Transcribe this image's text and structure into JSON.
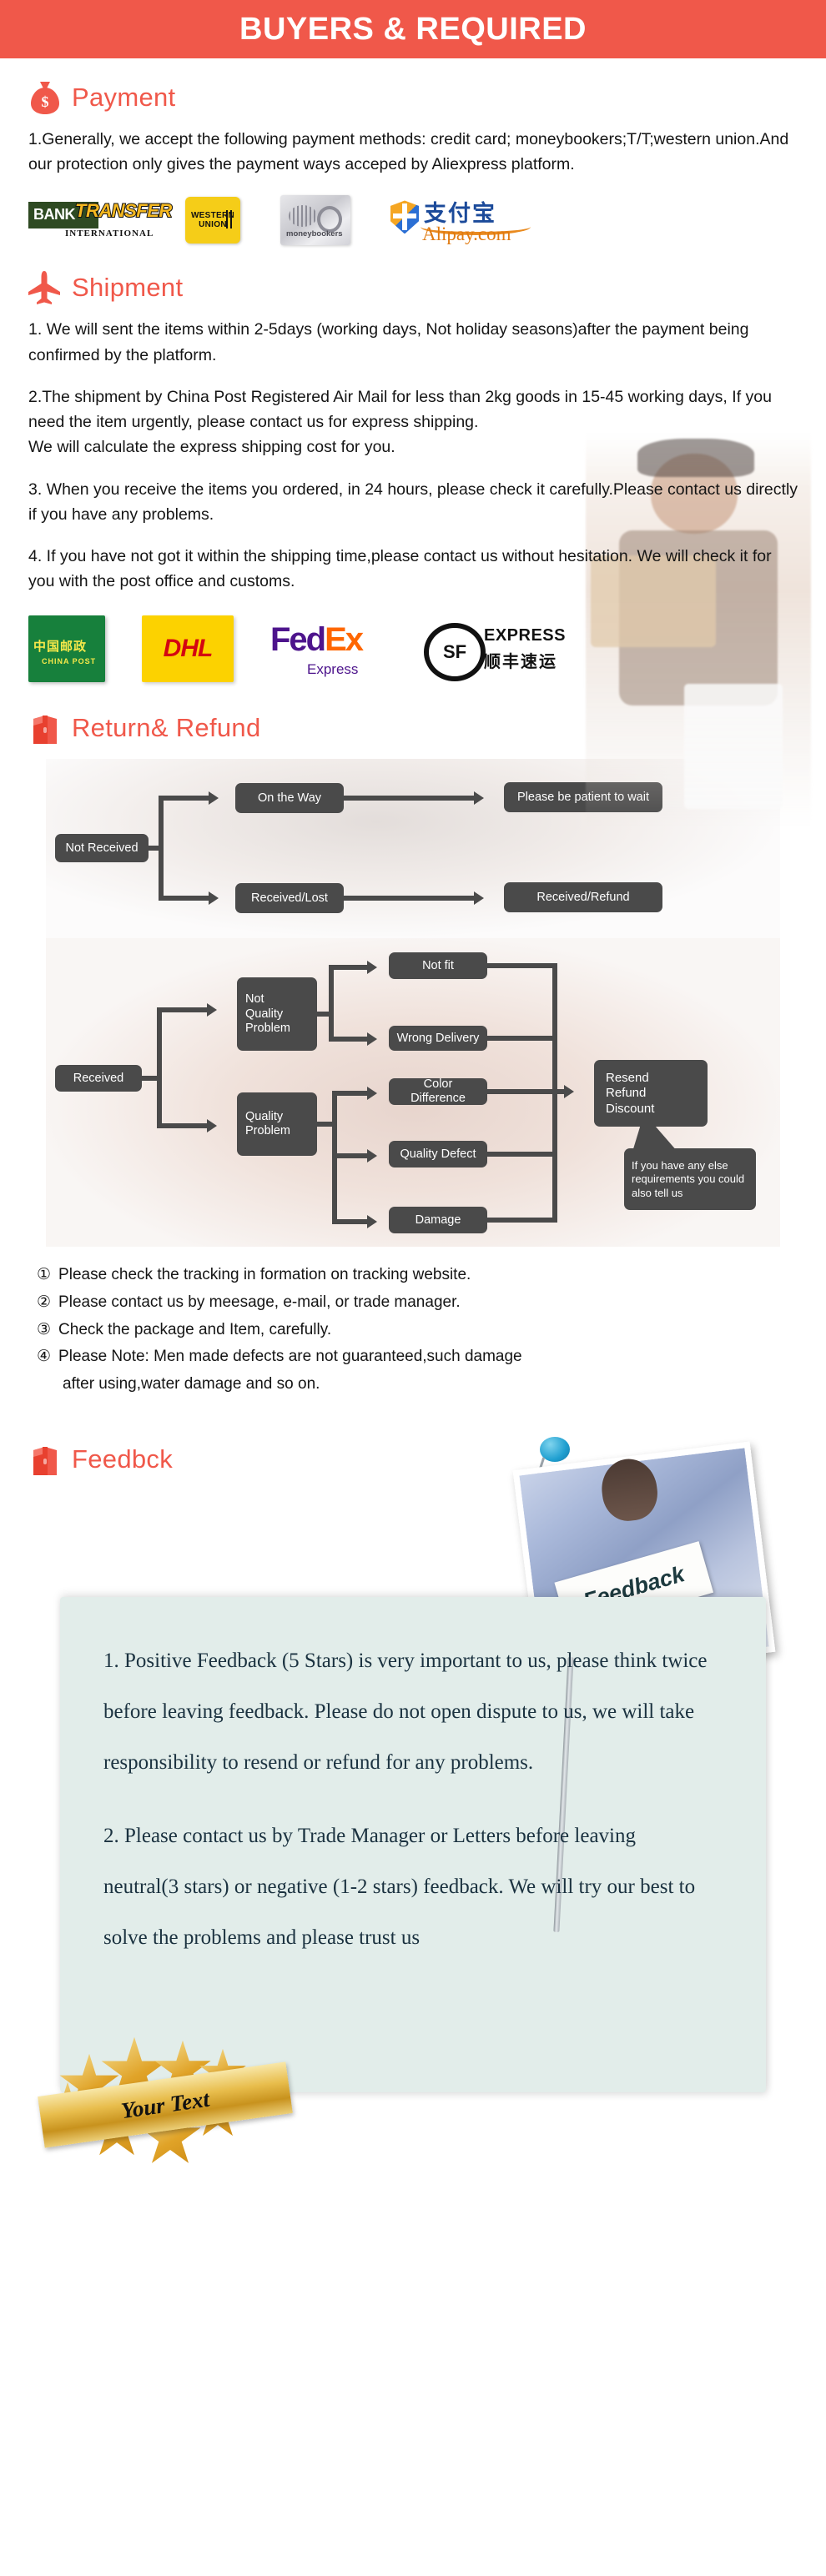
{
  "banner": {
    "title": "BUYERS & REQUIRED"
  },
  "payment": {
    "icon": "money-bag-icon",
    "heading": "Payment",
    "paragraph": "1.Generally, we accept the following payment methods: credit card; moneybookers;T/T;western union.And our protection only gives the payment ways acceped by Aliexpress platform.",
    "logos": [
      {
        "name": "bank-transfer-logo",
        "primary": "BANK",
        "secondary": "TRANSFER",
        "tertiary": "INTERNATIONAL"
      },
      {
        "name": "western-union-logo",
        "line1": "WESTERN",
        "line2": "UNION"
      },
      {
        "name": "moneybookers-logo",
        "label": "moneybookers"
      },
      {
        "name": "alipay-logo",
        "cn": "支付宝",
        "label": "Alipay.com"
      }
    ]
  },
  "shipment": {
    "icon": "airplane-icon",
    "heading": "Shipment",
    "items": [
      "1. We will sent the items within 2-5days (working days, Not holiday seasons)after the payment being confirmed by the platform.",
      "2.The shipment by China Post Registered Air Mail for less than  2kg goods in 15-45 working days, If  you need the item urgently, please contact us for express shipping.",
      "We will calculate the express shipping cost for you.",
      "3. When you receive the items you ordered, in 24 hours, please check  it carefully.Please contact us directly if you have any problems.",
      "4. If you have not got it within the shipping time,please contact us without hesitation. We will check it for you with the post office and customs."
    ],
    "carriers": [
      {
        "name": "china-post-logo",
        "cn": "中国邮政",
        "label": "CHINA POST"
      },
      {
        "name": "dhl-logo",
        "label": "DHL"
      },
      {
        "name": "fedex-logo",
        "fed": "Fed",
        "ex": "Ex",
        "sub": "Express"
      },
      {
        "name": "sf-express-logo",
        "mark": "SF",
        "label": "EXPRESS",
        "cn": "顺丰速运"
      }
    ]
  },
  "returns": {
    "icon": "gift-box-icon",
    "heading": "Return& Refund",
    "flow_not_received": {
      "root": "Not Received",
      "branches": [
        {
          "from": "On the Way",
          "to": "Please be patient to wait"
        },
        {
          "from": "Received/Lost",
          "to": "Received/Refund"
        }
      ]
    },
    "flow_received": {
      "root": "Received",
      "groups": [
        {
          "label": "Not\nQuality\nProblem",
          "children": [
            "Not fit",
            "Wrong Delivery"
          ]
        },
        {
          "label": "Quality\nProblem",
          "children": [
            "Color Difference",
            "Quality Defect",
            "Damage"
          ]
        }
      ],
      "outcome": "Resend\nRefund\nDiscount",
      "callout": "If you have any else requirements you could also tell us"
    },
    "notes": [
      {
        "num": "①",
        "text": "Please check the tracking in formation on tracking website."
      },
      {
        "num": "②",
        "text": "Please contact us by meesage, e-mail, or trade manager."
      },
      {
        "num": "③",
        "text": "Check the package and Item, carefully."
      },
      {
        "num": "④",
        "text": "Please Note: Men made defects  are not guaranteed,such damage",
        "sub": "after using,water damage and so on."
      }
    ]
  },
  "feedback": {
    "icon": "gift-box-icon",
    "heading": "Feedbck",
    "photo_sign": "Feedback",
    "paragraphs": [
      "1. Positive Feedback (5 Stars) is very important to us, please think twice before leaving feedback. Please do not open dispute to us,   we will take responsibility to resend or refund for any problems.",
      "2. Please contact us by Trade Manager or Letters before leaving neutral(3 stars) or negative (1-2 stars) feedback. We will try our best to solve the problems and please trust us"
    ],
    "badge_text": "Your Text"
  },
  "colors": {
    "accent": "#f0584a",
    "node": "#4a4a4a",
    "feedback_bg": "#e2edea",
    "feedback_text": "#1b3240"
  },
  "flow_nodes": {
    "not_received": "Not Received",
    "on_the_way": "On the Way",
    "patient": "Please be patient to wait",
    "received_lost": "Received/Lost",
    "received_refund": "Received/Refund",
    "received": "Received",
    "not_quality_1": "Not",
    "not_quality_2": "Quality",
    "not_quality_3": "Problem",
    "quality_1": "Quality",
    "quality_2": "Problem",
    "not_fit": "Not fit",
    "wrong_delivery": "Wrong Delivery",
    "color_difference": "Color Difference",
    "quality_defect": "Quality Defect",
    "damage": "Damage",
    "outcome_1": "Resend",
    "outcome_2": "Refund",
    "outcome_3": "Discount",
    "callout": "If you have any else requirements you could also tell us"
  }
}
